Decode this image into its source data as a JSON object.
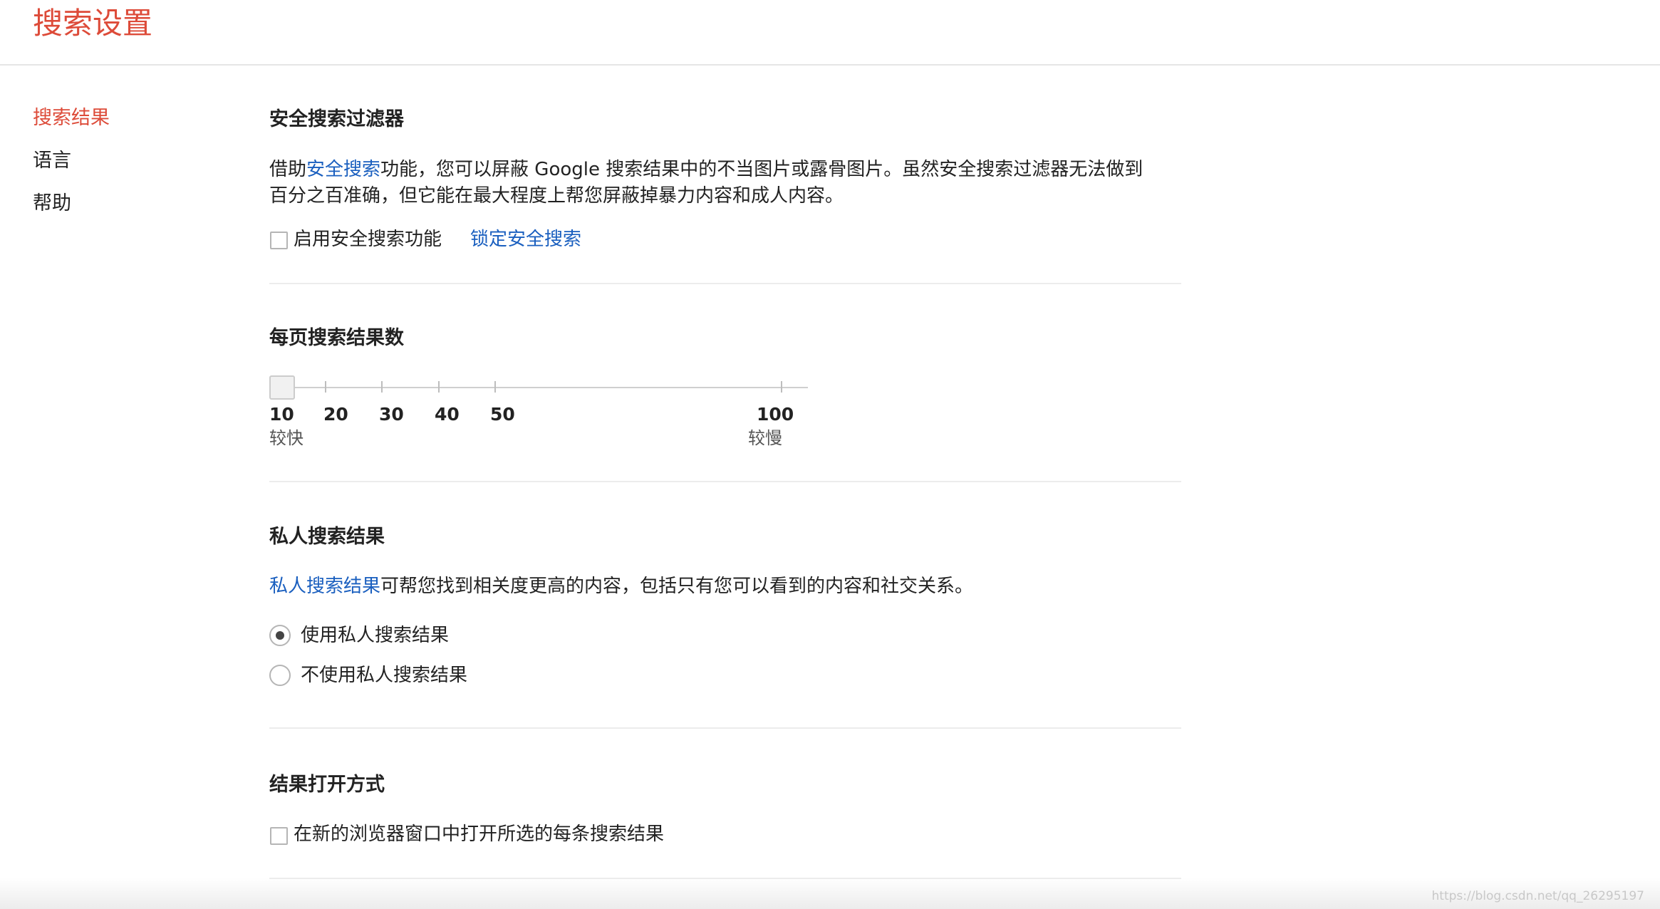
{
  "header": {
    "title": "搜索设置"
  },
  "sidebar": {
    "items": [
      {
        "label": "搜索结果",
        "active": true
      },
      {
        "label": "语言",
        "active": false
      },
      {
        "label": "帮助",
        "active": false
      }
    ]
  },
  "safesearch": {
    "title": "安全搜索过滤器",
    "desc_prefix": "借助",
    "desc_link": "安全搜索",
    "desc_line1_rest": "功能，您可以屏蔽 Google 搜索结果中的不当图片或露骨图片。虽然安全搜索过滤器无法做到",
    "desc_line2": "百分之百准确，但它能在最大程度上帮您屏蔽掉暴力内容和成人内容。",
    "checkbox_label": "启用安全搜索功能",
    "checkbox_checked": false,
    "lock_link": "锁定安全搜索"
  },
  "results_per_page": {
    "title": "每页搜索结果数",
    "ticks": [
      "10",
      "20",
      "30",
      "40",
      "50",
      "100"
    ],
    "selected": "10",
    "hint_fast": "较快",
    "hint_slow": "较慢"
  },
  "private_results": {
    "title": "私人搜索结果",
    "desc_link": "私人搜索结果",
    "desc_rest": "可帮您找到相关度更高的内容，包括只有您可以看到的内容和社交关系。",
    "options": [
      {
        "label": "使用私人搜索结果",
        "checked": true
      },
      {
        "label": "不使用私人搜索结果",
        "checked": false
      }
    ]
  },
  "open_results": {
    "title": "结果打开方式",
    "checkbox_label": "在新的浏览器窗口中打开所选的每条搜索结果",
    "checkbox_checked": false
  },
  "watermark": "https://blog.csdn.net/qq_26295197"
}
